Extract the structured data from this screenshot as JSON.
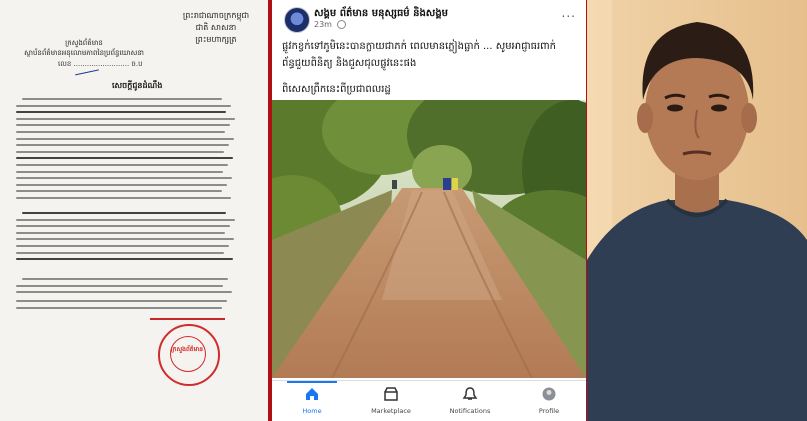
{
  "letter": {
    "header_right": [
      "ព្រះរាជាណាចក្រកម្ពុជា",
      "ជាតិ សាសនា ព្រះមហាក្សត្រ"
    ],
    "header_left": [
      "ក្រសួងព័ត៌មាន",
      "ស្ថាប័នព័ត៌មានអនុលោមភាពនៃប្រព័ន្ធឃោសនា"
    ],
    "number": "លេខ ......................... ច.ប",
    "title": "សេចក្ដីជូនដំណឹង",
    "stamp_text": "ក្រសួងព័ត៌មាន"
  },
  "post": {
    "page_name": "សង្គម ព័ត៌មាន មនុស្សធម៌ និងសង្គម",
    "time": "23m",
    "text": "ផ្លូវកខ្វក់ទៅភូមិនេះបានក្លាយជាភក់ ពេលមានភ្លៀងធ្លាក់ ... សូមអាជ្ញាធរពាក់ព័ន្ធជួយពិនិត្យ និងជួសជុលផ្លូវនេះផង",
    "link": "ពិសេសព្រឹកនេះពីប្រជាពលរដ្ឋ",
    "more_label": "..."
  },
  "nav": {
    "items": [
      {
        "label": "Home",
        "active": true
      },
      {
        "label": "Marketplace",
        "active": false
      },
      {
        "label": "Notifications",
        "active": false
      },
      {
        "label": "Profile",
        "active": false
      }
    ]
  },
  "colors": {
    "background_frame": "#b01015",
    "fb_blue": "#1877f2",
    "stamp_red": "#d32a2a"
  }
}
